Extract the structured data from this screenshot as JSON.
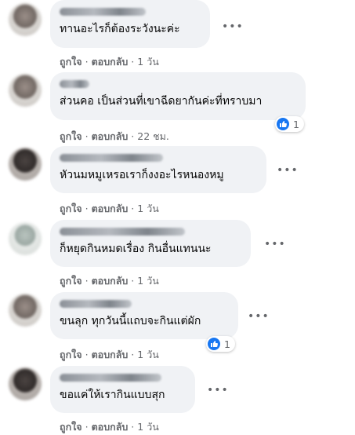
{
  "actions": {
    "like": "ถูกใจ",
    "reply": "ตอบกลับ",
    "separator": "·"
  },
  "comments": [
    {
      "text": "ทานอะไรก็ต้องระวังนะค่ะ",
      "time": "1 วัน",
      "reactions": ""
    },
    {
      "text": "ส่วนคอ เป็นส่วนที่เขาฉีดยากันค่ะที่ทราบมา",
      "time": "22 ชม.",
      "reactions": "1"
    },
    {
      "text": "หัวนมหมูเหรอเราก็งงอะไรหนองหมู",
      "time": "1 วัน",
      "reactions": ""
    },
    {
      "text": "ก็หยุดกินหมดเรื่อง กินอื่นแทนนะ",
      "time": "1 วัน",
      "reactions": ""
    },
    {
      "text": "ขนลุก ทุกวันนี้แถบจะกินแต่ผัก",
      "time": "1 วัน",
      "reactions": "1"
    },
    {
      "text": "ขอแค่ให้เรากินแบบสุก",
      "time": "1 วัน",
      "reactions": ""
    }
  ],
  "icons": {
    "like": "thumbs-up-icon",
    "more": "more-horizontal-icon"
  },
  "colors": {
    "bubble": "#f0f2f5",
    "meta": "#65676b",
    "like_blue": "#1877f2",
    "text": "#050505"
  }
}
